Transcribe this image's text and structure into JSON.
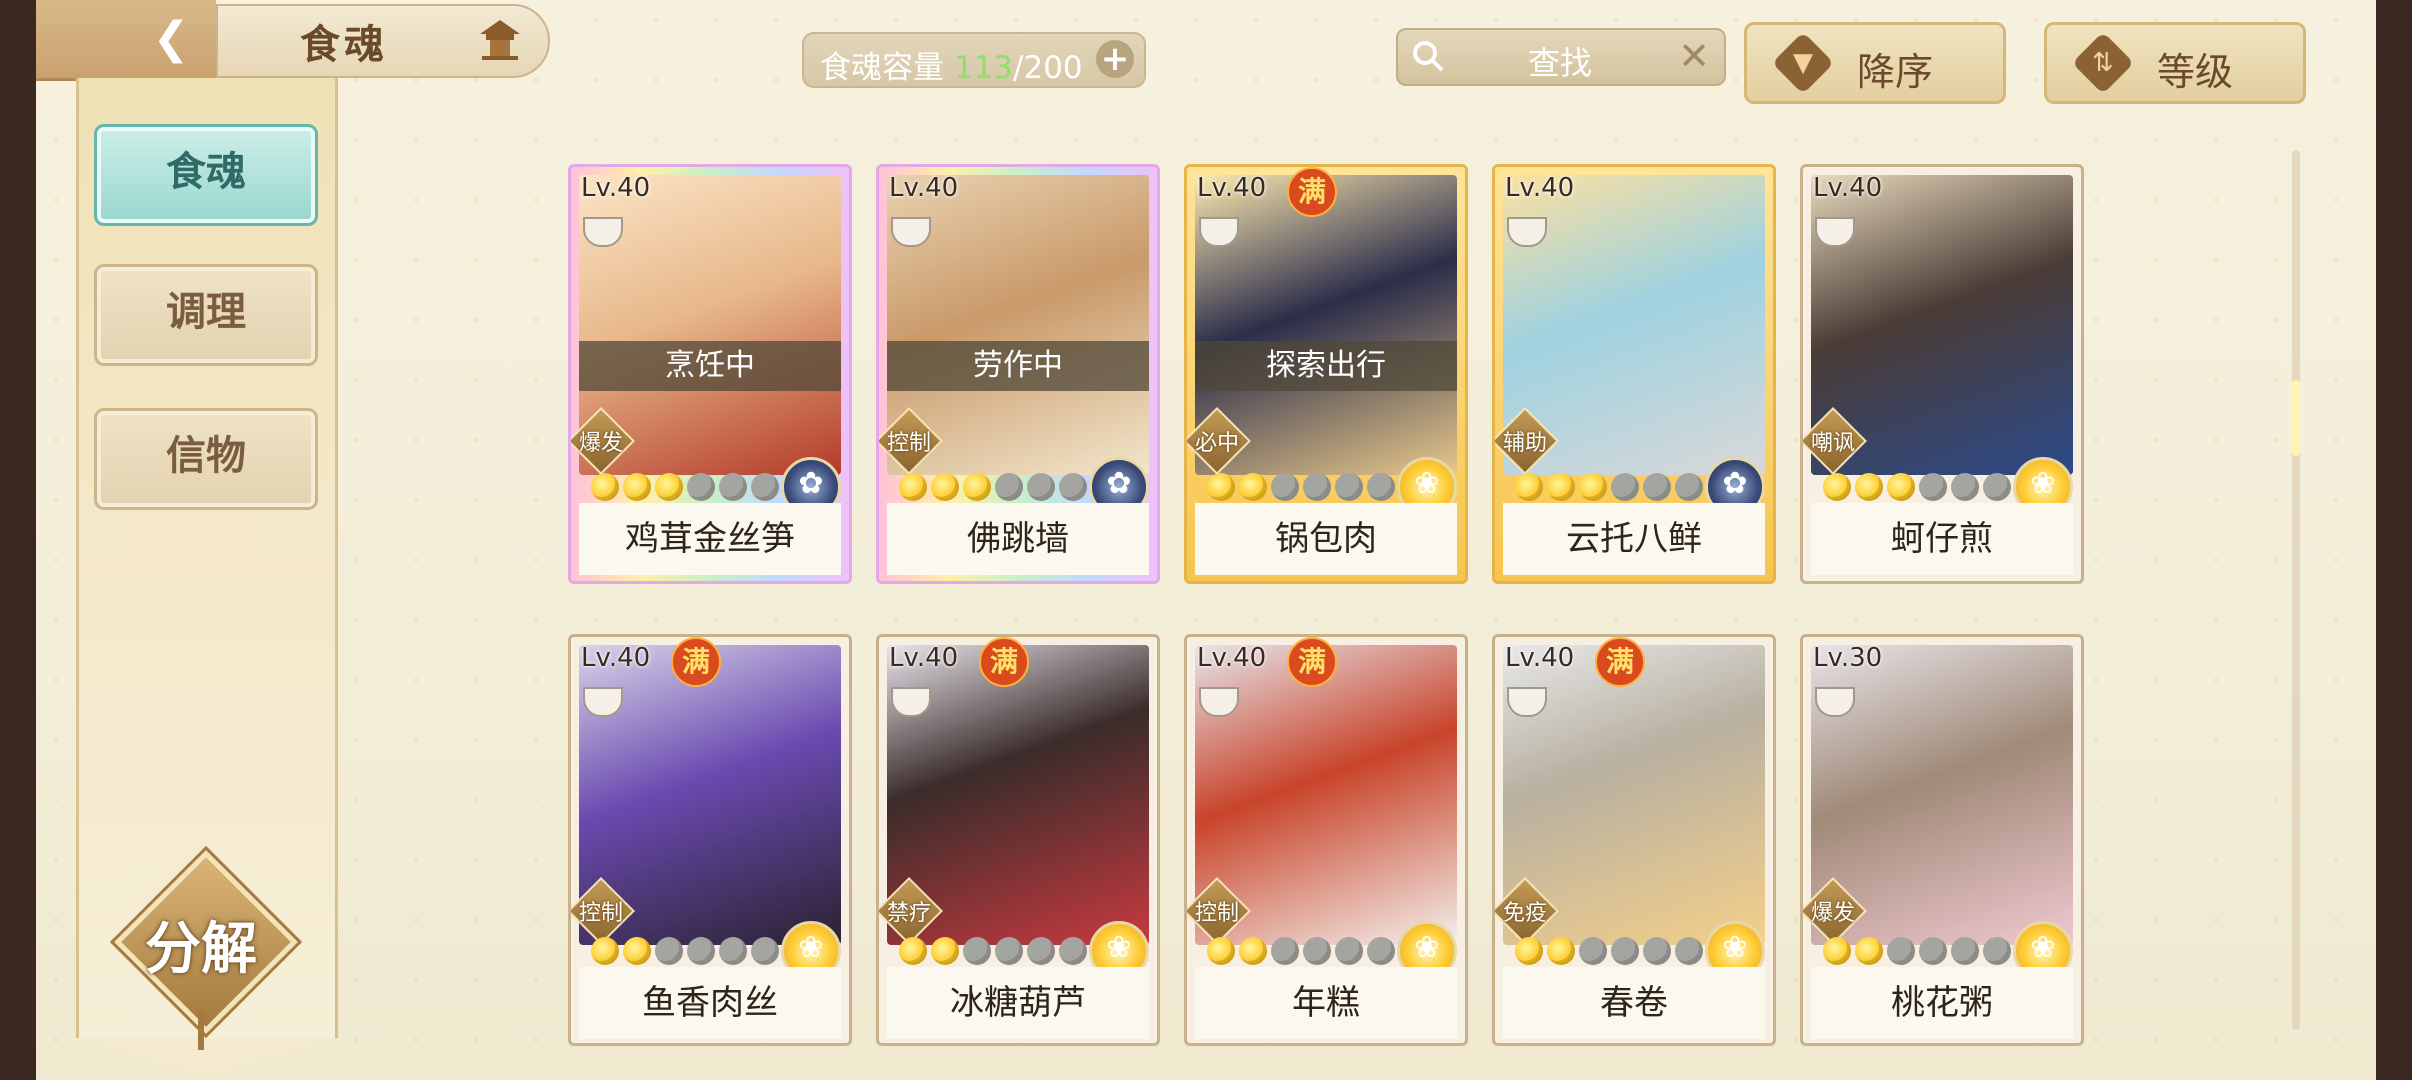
{
  "header": {
    "title": "食魂",
    "capacity_label": "食魂容量",
    "capacity_current": "113",
    "capacity_max": "/200",
    "search_placeholder": "查找",
    "sort_order_label": "降序",
    "sort_field_label": "等级"
  },
  "sidebar": {
    "tabs": [
      {
        "label": "食魂",
        "active": true
      },
      {
        "label": "调理",
        "active": false
      },
      {
        "label": "信物",
        "active": false
      }
    ],
    "decompose_label": "分解"
  },
  "colors": {
    "accent_teal": "#99d7cf",
    "capacity_green": "#8ee06a",
    "full_badge": "#d94a1e"
  },
  "cards": [
    {
      "level": "Lv.40",
      "name": "鸡茸金丝笋",
      "role": "爆发",
      "status": "烹饪中",
      "full": "",
      "stars": 3,
      "emblem": "blue-gear-icon",
      "frame": "rainbow"
    },
    {
      "level": "Lv.40",
      "name": "佛跳墙",
      "role": "控制",
      "status": "劳作中",
      "full": "",
      "stars": 3,
      "emblem": "blue-gear-icon",
      "frame": "rainbow"
    },
    {
      "level": "Lv.40",
      "name": "锅包肉",
      "role": "必中",
      "status": "探索出行",
      "full": "满",
      "stars": 2,
      "emblem": "flower-icon",
      "frame": "gold"
    },
    {
      "level": "Lv.40",
      "name": "云托八鲜",
      "role": "辅助",
      "status": "",
      "full": "",
      "stars": 3,
      "emblem": "blue-gear-icon",
      "frame": "gold"
    },
    {
      "level": "Lv.40",
      "name": "蚵仔煎",
      "role": "嘲讽",
      "status": "",
      "full": "",
      "stars": 3,
      "emblem": "flower-icon",
      "frame": "plain"
    },
    {
      "level": "Lv.40",
      "name": "鱼香肉丝",
      "role": "控制",
      "status": "",
      "full": "满",
      "stars": 2,
      "emblem": "flower-icon",
      "frame": "plain"
    },
    {
      "level": "Lv.40",
      "name": "冰糖葫芦",
      "role": "禁疗",
      "status": "",
      "full": "满",
      "stars": 2,
      "emblem": "flower-icon",
      "frame": "plain"
    },
    {
      "level": "Lv.40",
      "name": "年糕",
      "role": "控制",
      "status": "",
      "full": "满",
      "stars": 2,
      "emblem": "flower-icon",
      "frame": "plain"
    },
    {
      "level": "Lv.40",
      "name": "春卷",
      "role": "免疫",
      "status": "",
      "full": "满",
      "stars": 2,
      "emblem": "flower-icon",
      "frame": "plain"
    },
    {
      "level": "Lv.30",
      "name": "桃花粥",
      "role": "爆发",
      "status": "",
      "full": "",
      "stars": 2,
      "emblem": "flower-icon",
      "frame": "plain"
    }
  ]
}
